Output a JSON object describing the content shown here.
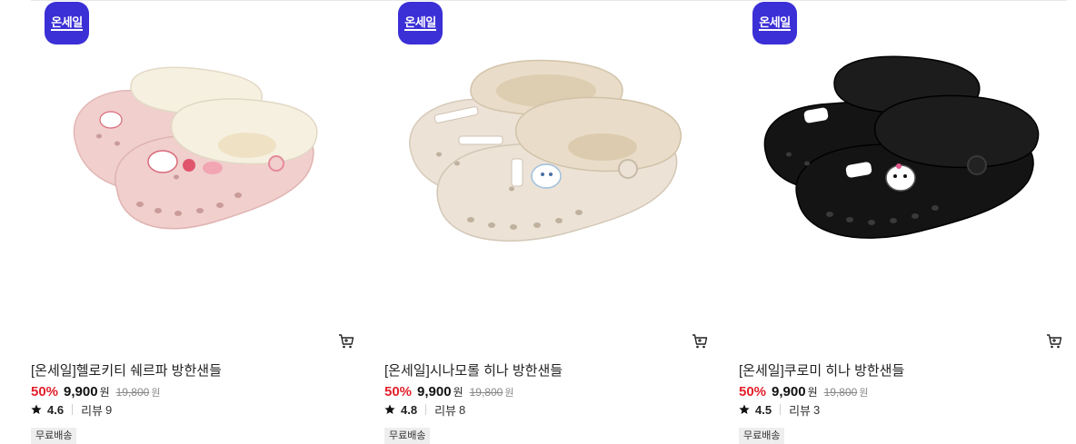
{
  "products": [
    {
      "badge": "온세일",
      "title": "[온세일]헬로키티 쉐르파 방한샌들",
      "discount": "50%",
      "price": "9,900",
      "price_unit": "원",
      "original_price": "19,800",
      "original_unit": "원",
      "rating": "4.6",
      "review_label": "리뷰",
      "review_count": "9",
      "tag": "무료배송",
      "colors": {
        "shoe": "#f0cfcd",
        "fur": "#f6f0e1"
      }
    },
    {
      "badge": "온세일",
      "title": "[온세일]시나모롤 히나 방한샌들",
      "discount": "50%",
      "price": "9,900",
      "price_unit": "원",
      "original_price": "19,800",
      "original_unit": "원",
      "rating": "4.8",
      "review_label": "리뷰",
      "review_count": "8",
      "tag": "무료배송",
      "colors": {
        "shoe": "#ece2d6",
        "fur": "#e9ddc9"
      }
    },
    {
      "badge": "온세일",
      "title": "[온세일]쿠로미 히나 방한샌들",
      "discount": "50%",
      "price": "9,900",
      "price_unit": "원",
      "original_price": "19,800",
      "original_unit": "원",
      "rating": "4.5",
      "review_label": "리뷰",
      "review_count": "3",
      "tag": "무료배송",
      "colors": {
        "shoe": "#141414",
        "fur": "#1c1c1c"
      }
    }
  ],
  "accent_colors": {
    "badge": "#3b2fd6",
    "discount": "#e3202c"
  },
  "icons": {
    "cart": "cart-icon",
    "star": "star-icon"
  }
}
